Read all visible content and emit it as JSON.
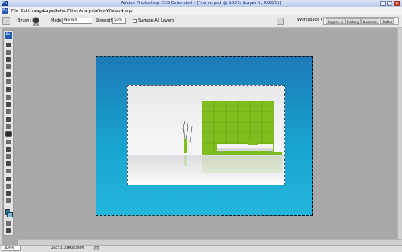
{
  "window": {
    "title": "Adobe Photoshop CS3 Extended - [Frame.psd @ 100% (Layer 9, RGB/8)]",
    "app_badge": "Ps",
    "controls": [
      "_",
      "□",
      "x"
    ]
  },
  "menu": {
    "items": [
      "File",
      "Edit",
      "Image",
      "Layer",
      "Select",
      "Filter",
      "Analysis",
      "View",
      "Window",
      "Help"
    ]
  },
  "options": {
    "brush_label": "Brush:",
    "brush_size": "900",
    "mode_label": "Mode:",
    "mode_value": "Normal",
    "strength_label": "Strength:",
    "strength_value": "50%",
    "sample_all_layers": "Sample All Layers",
    "workspace": "Workspace ▾",
    "panel_tabs": [
      "Layers ×",
      "history",
      "brushes",
      "Paths"
    ]
  },
  "toolbox": {
    "badge": "Ps",
    "foreground_color": "#1a7fb1",
    "background_color": "#6ac3e6"
  },
  "document": {
    "canvas_gradient_top": "#1c79b7",
    "canvas_gradient_bottom": "#24b6dc",
    "photo_accent_green": "#7fbe1f"
  },
  "status": {
    "zoom": "100%",
    "doc_info": "Doc: 1.03M/8.49M"
  }
}
